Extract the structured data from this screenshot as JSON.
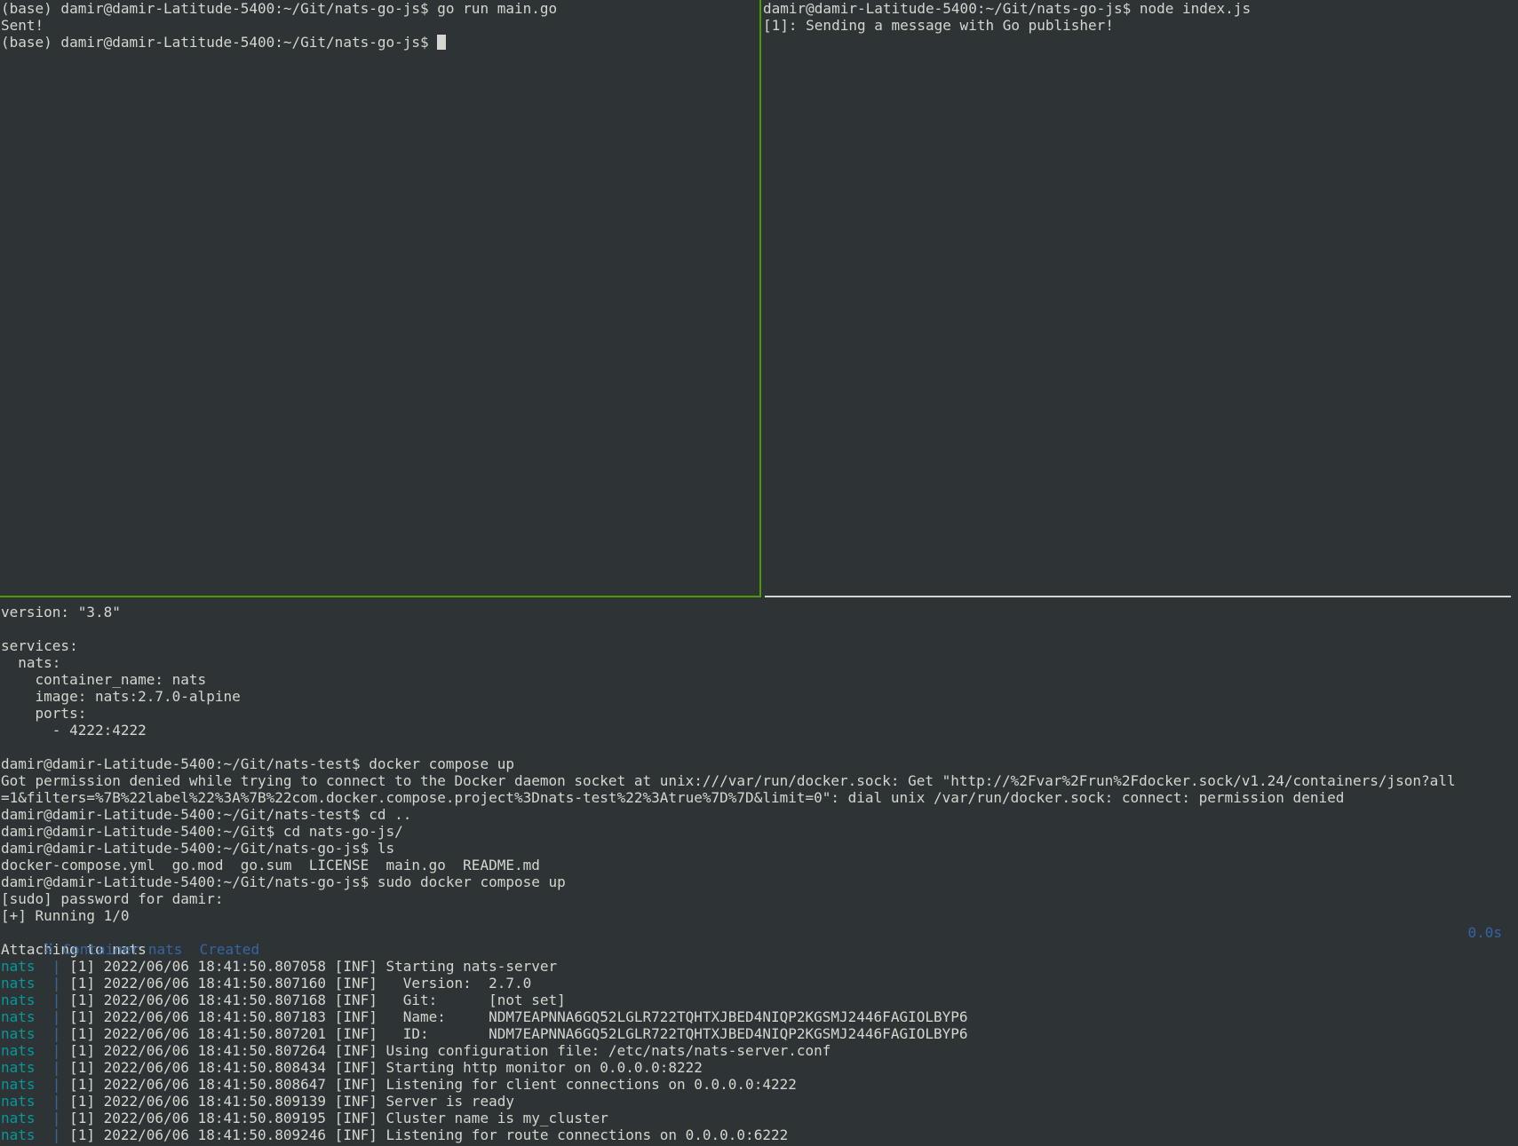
{
  "window": {
    "accent_divider": "#4e9a06",
    "background": "#2e3436",
    "foreground": "#d3d7cf"
  },
  "top_left": {
    "lines": [
      "(base) damir@damir-Latitude-5400:~/Git/nats-go-js$ go run main.go",
      "Sent!"
    ],
    "prompt": "(base) damir@damir-Latitude-5400:~/Git/nats-go-js$ "
  },
  "top_right": {
    "lines": [
      "damir@damir-Latitude-5400:~/Git/nats-go-js$ node index.js",
      "[1]: Sending a message with Go publisher!"
    ]
  },
  "bottom": {
    "compose_file": [
      "version: \"3.8\"",
      "",
      "services:",
      "  nats:",
      "    container_name: nats",
      "    image: nats:2.7.0-alpine",
      "    ports:",
      "      - 4222:4222",
      ""
    ],
    "shell": [
      "damir@damir-Latitude-5400:~/Git/nats-test$ docker compose up",
      "Got permission denied while trying to connect to the Docker daemon socket at unix:///var/run/docker.sock: Get \"http://%2Fvar%2Frun%2Fdocker.sock/v1.24/containers/json?all",
      "=1&filters=%7B%22label%22%3A%7B%22com.docker.compose.project%3Dnats-test%22%3Atrue%7D%7D&limit=0\": dial unix /var/run/docker.sock: connect: permission denied",
      "damir@damir-Latitude-5400:~/Git/nats-test$ cd ..",
      "damir@damir-Latitude-5400:~/Git$ cd nats-go-js/",
      "damir@damir-Latitude-5400:~/Git/nats-go-js$ ls",
      "docker-compose.yml  go.mod  go.sum  LICENSE  main.go  README.md",
      "damir@damir-Latitude-5400:~/Git/nats-go-js$ sudo docker compose up",
      "[sudo] password for damir:",
      "[+] Running 1/0"
    ],
    "container_status": {
      "text": " ⠿ Container nats  Created",
      "time": "0.0s"
    },
    "attaching": "Attaching to nats",
    "log_service": "nats",
    "log_separator": "  | ",
    "logs": [
      "[1] 2022/06/06 18:41:50.807058 [INF] Starting nats-server",
      "[1] 2022/06/06 18:41:50.807160 [INF]   Version:  2.7.0",
      "[1] 2022/06/06 18:41:50.807168 [INF]   Git:      [not set]",
      "[1] 2022/06/06 18:41:50.807183 [INF]   Name:     NDM7EAPNNA6GQ52LGLR722TQHTXJBED4NIQP2KGSMJ2446FAGIOLBYP6",
      "[1] 2022/06/06 18:41:50.807201 [INF]   ID:       NDM7EAPNNA6GQ52LGLR722TQHTXJBED4NIQP2KGSMJ2446FAGIOLBYP6",
      "[1] 2022/06/06 18:41:50.807264 [INF] Using configuration file: /etc/nats/nats-server.conf",
      "[1] 2022/06/06 18:41:50.808434 [INF] Starting http monitor on 0.0.0.0:8222",
      "[1] 2022/06/06 18:41:50.808647 [INF] Listening for client connections on 0.0.0.0:4222",
      "[1] 2022/06/06 18:41:50.809139 [INF] Server is ready",
      "[1] 2022/06/06 18:41:50.809195 [INF] Cluster name is my_cluster",
      "[1] 2022/06/06 18:41:50.809246 [INF] Listening for route connections on 0.0.0.0:6222"
    ]
  }
}
